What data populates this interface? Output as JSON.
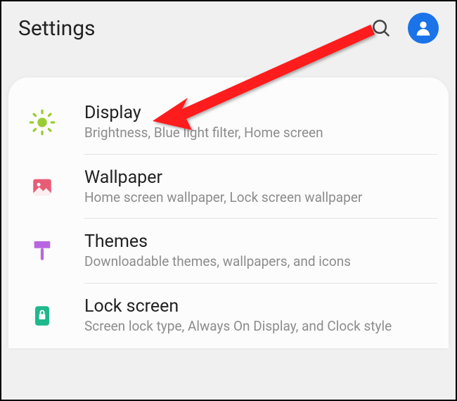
{
  "header": {
    "title": "Settings"
  },
  "items": [
    {
      "title": "Display",
      "subtitle": "Brightness, Blue light filter, Home screen"
    },
    {
      "title": "Wallpaper",
      "subtitle": "Home screen wallpaper, Lock screen wallpaper"
    },
    {
      "title": "Themes",
      "subtitle": "Downloadable themes, wallpapers, and icons"
    },
    {
      "title": "Lock screen",
      "subtitle": "Screen lock type, Always On Display, and Clock style"
    }
  ]
}
